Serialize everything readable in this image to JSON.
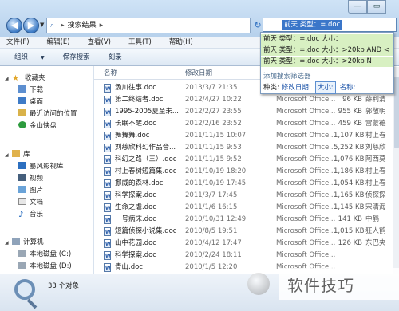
{
  "window": {
    "minimize_label": "—",
    "maximize_label": "▭"
  },
  "address": {
    "crumb": "搜索结果",
    "separator": "▸"
  },
  "search": {
    "query": "前天 类型：=.doc",
    "history": [
      "前天 类型：=.doc 大小：",
      "前天 类型：=.doc 大小：>20kb AND <",
      "前天 类型：=.doc 大小：>20kb N"
    ],
    "add_filter_label": "添加搜索筛选器",
    "filters_label": "种类:",
    "filters": [
      "修改日期:",
      "大小:",
      "名称:"
    ]
  },
  "menubar": {
    "items": [
      "文件(F)",
      "编辑(E)",
      "查看(V)",
      "工具(T)",
      "帮助(H)"
    ]
  },
  "toolbar": {
    "organize": "组织",
    "save_search": "保存搜索",
    "burn": "刻录"
  },
  "nav": {
    "favorites": "收藏夹",
    "favorites_items": [
      "下载",
      "桌面",
      "最近访问的位置",
      "金山快盘"
    ],
    "libraries": "库",
    "libraries_items": [
      "暴风影视库",
      "视频",
      "图片",
      "文档",
      "音乐"
    ],
    "computer": "计算机",
    "computer_items": [
      "本地磁盘 (C:)",
      "本地磁盘 (D:)"
    ]
  },
  "columns": {
    "name": "名称",
    "date": "修改日期",
    "type": "类型",
    "size": "大小",
    "author": "作者"
  },
  "files": [
    {
      "name": "汤川往事.doc",
      "date": "2013/3/7 21:35",
      "type": "Microsoft Office...",
      "size": "",
      "author": ""
    },
    {
      "name": "第二终结者.doc",
      "date": "2012/4/27 10:22",
      "type": "Microsoft Office...",
      "size": "96 KB",
      "author": "薛利清"
    },
    {
      "name": "1995-2005夏至未...",
      "date": "2012/2/27 23:55",
      "type": "Microsoft Office...",
      "size": "955 KB",
      "author": "郭敬明"
    },
    {
      "name": "长眠不醒.doc",
      "date": "2012/2/16 23:52",
      "type": "Microsoft Office...",
      "size": "459 KB",
      "author": "雷蒙德"
    },
    {
      "name": "舞舞舞.doc",
      "date": "2011/11/15 10:07",
      "type": "Microsoft Office...",
      "size": "1,107 KB",
      "author": "村上春"
    },
    {
      "name": "刘慈欣科幻作品合...",
      "date": "2011/11/15 9:53",
      "type": "Microsoft Office...",
      "size": "5,252 KB",
      "author": "刘慈欣"
    },
    {
      "name": "科幻之路（三）.doc",
      "date": "2011/11/15 9:52",
      "type": "Microsoft Office...",
      "size": "1,076 KB",
      "author": "阿西莫"
    },
    {
      "name": "村上春树短篇集.doc",
      "date": "2011/10/19 18:20",
      "type": "Microsoft Office...",
      "size": "1,186 KB",
      "author": "村上春"
    },
    {
      "name": "挪威的森林.doc",
      "date": "2011/10/19 17:45",
      "type": "Microsoft Office...",
      "size": "1,054 KB",
      "author": "村上春"
    },
    {
      "name": "科学探案.doc",
      "date": "2011/3/7 17:45",
      "type": "Microsoft Office...",
      "size": "1,165 KB",
      "author": "侦探探"
    },
    {
      "name": "生命之虐.doc",
      "date": "2011/1/6 16:15",
      "type": "Microsoft Office...",
      "size": "1,145 KB",
      "author": "宋清海"
    },
    {
      "name": "一号病床.doc",
      "date": "2010/10/31 12:49",
      "type": "Microsoft Office...",
      "size": "141 KB",
      "author": "中鹤"
    },
    {
      "name": "短篇侦探小说集.doc",
      "date": "2010/8/5 19:51",
      "type": "Microsoft Office...",
      "size": "1,015 KB",
      "author": "狂人鹤"
    },
    {
      "name": "山中花园.doc",
      "date": "2010/4/12 17:47",
      "type": "Microsoft Office...",
      "size": "126 KB",
      "author": "东巴夹"
    },
    {
      "name": "科学探案.doc",
      "date": "2010/2/24 18:11",
      "type": "Microsoft Office...",
      "size": "",
      "author": ""
    },
    {
      "name": "青山.doc",
      "date": "2010/1/5 12:20",
      "type": "Microsoft Office...",
      "size": "",
      "author": ""
    }
  ],
  "status": {
    "count": "33 个对象"
  },
  "watermark": {
    "text": "软件技巧"
  },
  "colors": {
    "accent": "#3a76c9",
    "history_bg": "#d8f0c2",
    "title_bg": "#b7d1ec"
  }
}
